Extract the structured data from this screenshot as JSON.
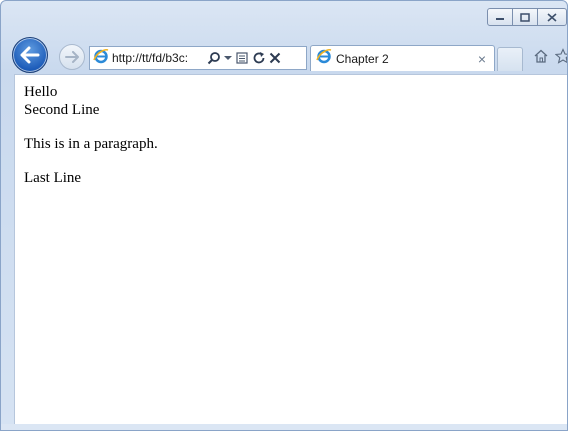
{
  "browser": {
    "address": {
      "url": "http://tt/fd/b3c:",
      "page_icon": "ie-icon",
      "search_icon": "search-icon",
      "dropdown_icon": "chevron-down-icon",
      "compat_icon": "compatibility-view-icon",
      "refresh_icon": "refresh-icon",
      "stop_icon": "close-icon"
    },
    "tab": {
      "title": "Chapter 2",
      "close_label": "×"
    },
    "caption": {
      "minimize_icon": "minimize-icon",
      "maximize_icon": "maximize-icon",
      "close_icon": "close-icon"
    },
    "accent_color": "#1d5cb9"
  },
  "page": {
    "line1": "Hello",
    "line2": "Second Line",
    "paragraph": "This is in a paragraph.",
    "last_line": "Last Line"
  }
}
